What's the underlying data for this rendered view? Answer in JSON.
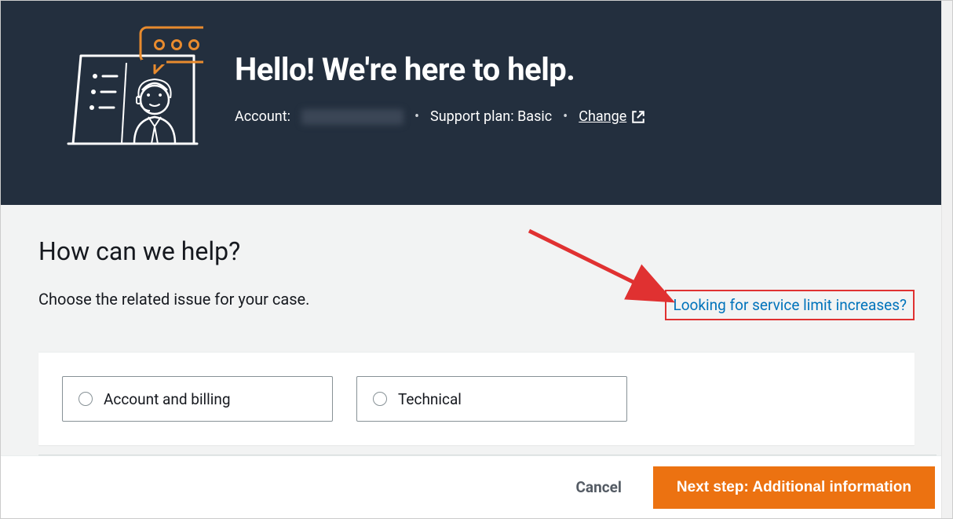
{
  "hero": {
    "title": "Hello!  We're here to help.",
    "account_label": "Account:",
    "support_plan": "Support plan: Basic",
    "change_label": "Change"
  },
  "main": {
    "title": "How can we help?",
    "subtitle": "Choose the related issue for your case.",
    "limit_link": "Looking for service limit increases?",
    "options": [
      {
        "label": "Account and billing"
      },
      {
        "label": "Technical"
      }
    ]
  },
  "footer": {
    "cancel": "Cancel",
    "next": "Next step: Additional information"
  }
}
